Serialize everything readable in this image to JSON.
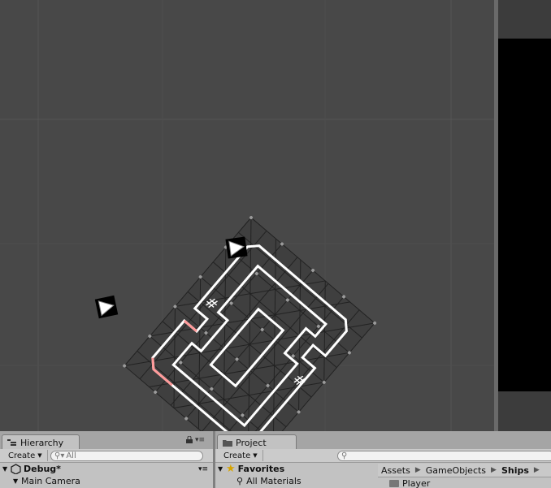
{
  "hierarchy": {
    "tab_label": "Hierarchy",
    "create_label": "Create",
    "search_placeholder": "All",
    "scene_name": "Debug*",
    "items": [
      {
        "label": "Main Camera"
      }
    ]
  },
  "project": {
    "tab_label": "Project",
    "create_label": "Create",
    "favorites_label": "Favorites",
    "favorites_items": [
      {
        "label": "All Materials"
      }
    ],
    "breadcrumb": [
      "Assets",
      "GameObjects",
      "Ships"
    ],
    "folder_items": [
      {
        "label": "Player"
      }
    ]
  },
  "icons": {
    "camera": "camera-gizmo-icon",
    "lock": "lock-icon",
    "menu": "panel-menu-icon",
    "star": "star-icon",
    "unity": "unity-logo-icon",
    "search": "search-icon"
  },
  "colors": {
    "scene_background": "#484848",
    "grid_line": "#555555",
    "ship_outline": "#ffffff",
    "ship_highlight": "#ff9a9a",
    "panel_background": "#c2c2c2"
  }
}
